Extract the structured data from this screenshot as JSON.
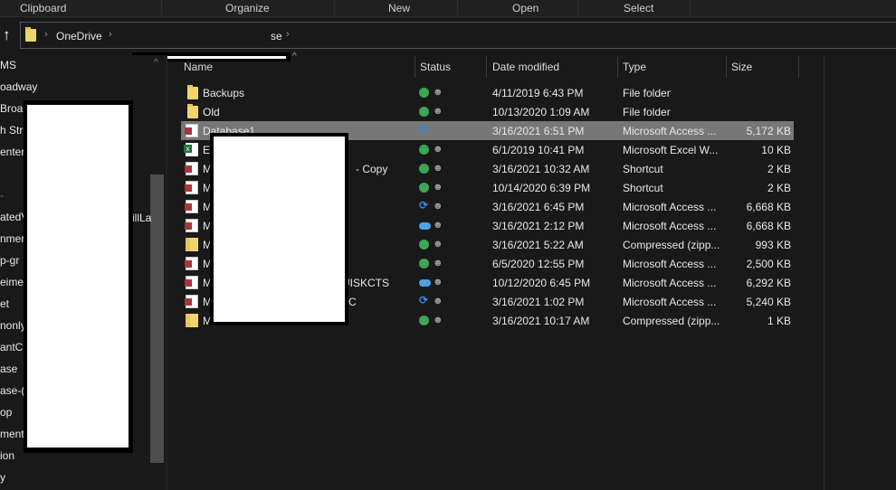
{
  "ribbon": {
    "groups": [
      "Clipboard",
      "Organize",
      "New",
      "Open",
      "Select"
    ]
  },
  "address": {
    "crumbs": [
      "OneDrive",
      "se"
    ]
  },
  "sidebar": {
    "items": [
      "MS",
      "oadway",
      "Broad",
      "h Str",
      "enter",
      "",
      "-",
      "atedV",
      "nmer",
      "p-gr",
      "eime",
      "et",
      "nonly",
      "antC",
      "ase",
      "ase-(",
      "op",
      "ment",
      "ion",
      "y"
    ],
    "overflow_text": "illLa"
  },
  "columns": {
    "name": "Name",
    "status": "Status",
    "date": "Date modified",
    "type": "Type",
    "size": "Size"
  },
  "files": [
    {
      "name": "Backups",
      "icon": "folder",
      "status": "ok",
      "date": "4/11/2019 6:43 PM",
      "type": "File folder",
      "size": ""
    },
    {
      "name": "Old",
      "icon": "folder",
      "status": "ok",
      "date": "10/13/2020 1:09 AM",
      "type": "File folder",
      "size": ""
    },
    {
      "name": "Database1",
      "icon": "access",
      "status": "sync",
      "date": "3/16/2021 6:51 PM",
      "type": "Microsoft Access ...",
      "size": "5,172 KB"
    },
    {
      "name": "E",
      "icon": "excel",
      "status": "ok",
      "date": "6/1/2019 10:41 PM",
      "type": "Microsoft Excel W...",
      "size": "10 KB"
    },
    {
      "name": "M",
      "tail": "- Copy",
      "icon": "access",
      "status": "ok",
      "date": "3/16/2021 10:32 AM",
      "type": "Shortcut",
      "size": "2 KB"
    },
    {
      "name": "M",
      "icon": "access",
      "status": "ok",
      "date": "10/14/2020 6:39 PM",
      "type": "Shortcut",
      "size": "2 KB"
    },
    {
      "name": "M",
      "icon": "access",
      "status": "sync",
      "date": "3/16/2021 6:45 PM",
      "type": "Microsoft Access ...",
      "size": "6,668 KB"
    },
    {
      "name": "M",
      "icon": "access",
      "status": "cloud",
      "date": "3/16/2021 2:12 PM",
      "type": "Microsoft Access ...",
      "size": "6,668 KB"
    },
    {
      "name": "M",
      "icon": "zip",
      "status": "ok",
      "date": "3/16/2021 5:22 AM",
      "type": "Compressed (zipp...",
      "size": "993 KB"
    },
    {
      "name": "M",
      "icon": "access",
      "status": "ok",
      "date": "6/5/2020 12:55 PM",
      "type": "Microsoft Access ...",
      "size": "2,500 KB"
    },
    {
      "name": "M",
      "tail": "UISKCTS",
      "icon": "access",
      "status": "cloud",
      "date": "10/12/2020 6:45 PM",
      "type": "Microsoft Access ...",
      "size": "6,292 KB"
    },
    {
      "name": "M",
      "tail": "C",
      "icon": "access",
      "status": "sync",
      "date": "3/16/2021 1:02 PM",
      "type": "Microsoft Access ...",
      "size": "5,240 KB"
    },
    {
      "name": "M",
      "icon": "zip",
      "status": "ok",
      "date": "3/16/2021 10:17 AM",
      "type": "Compressed (zipp...",
      "size": "1 KB"
    }
  ],
  "selected_index": 2
}
